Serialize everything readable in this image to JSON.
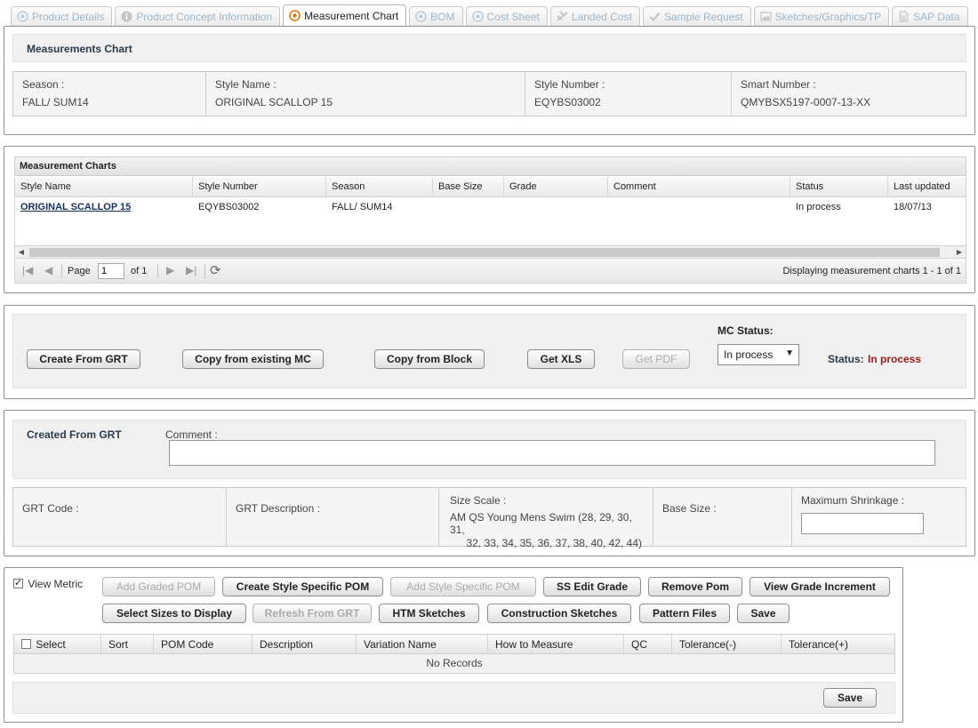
{
  "tabs": [
    {
      "label": "Product Details",
      "icon": "eye-icon",
      "active": false
    },
    {
      "label": "Product Concept Information",
      "icon": "info-icon",
      "active": false
    },
    {
      "label": "Measurement Chart",
      "icon": "eye-icon",
      "active": true
    },
    {
      "label": "BOM",
      "icon": "eye-icon",
      "active": false
    },
    {
      "label": "Cost Sheet",
      "icon": "eye-icon",
      "active": false
    },
    {
      "label": "Landed Cost",
      "icon": "plane-icon",
      "active": false
    },
    {
      "label": "Sample Request",
      "icon": "check-icon",
      "active": false
    },
    {
      "label": "Sketches/Graphics/TP",
      "icon": "image-icon",
      "active": false
    },
    {
      "label": "SAP Data",
      "icon": "document-icon",
      "active": false
    }
  ],
  "summary": {
    "title": "Measurements Chart",
    "season_label": "Season :",
    "season_value": "FALL/ SUM14",
    "style_name_label": "Style Name :",
    "style_name_value": "ORIGINAL SCALLOP 15",
    "style_number_label": "Style Number :",
    "style_number_value": "EQYBS03002",
    "smart_number_label": "Smart Number :",
    "smart_number_value": "QMYBSX5197-0007-13-XX"
  },
  "grid": {
    "title": "Measurement Charts",
    "columns": [
      "Style Name",
      "Style Number",
      "Season",
      "Base Size",
      "Grade",
      "Comment",
      "Status",
      "Last updated"
    ],
    "rows": [
      {
        "style_name": "ORIGINAL SCALLOP 15",
        "style_number": "EQYBS03002",
        "season": "FALL/ SUM14",
        "base_size": "",
        "grade": "",
        "comment": "",
        "status": "In process",
        "last_updated": "18/07/13"
      }
    ],
    "pager": {
      "page_label": "Page",
      "page_value": "1",
      "of_label": "of 1",
      "display_text": "Displaying measurement charts 1 - 1 of 1"
    }
  },
  "actions": {
    "create_from_grt": "Create From GRT",
    "copy_existing": "Copy from existing MC",
    "copy_block": "Copy from Block",
    "get_xls": "Get XLS",
    "get_pdf": "Get PDF",
    "mc_status_label": "MC Status:",
    "mc_status_value": "In process",
    "status_label": "Status:",
    "status_value": "In process",
    "status_color": "#9b1b1b"
  },
  "grt": {
    "created_from": "Created From GRT",
    "comment_label": "Comment :",
    "comment_value": "",
    "grt_code_label": "GRT Code :",
    "grt_desc_label": "GRT Description :",
    "size_scale_label": "Size Scale :",
    "size_scale_value_1": "AM QS Young Mens Swim (28, 29, 30, 31,",
    "size_scale_value_2": "32, 33, 34, 35, 36, 37, 38, 40, 42, 44)",
    "base_size_label": "Base Size :",
    "max_shrink_label": "Maximum Shrinkage :",
    "max_shrink_value": ""
  },
  "pom": {
    "view_metric": "View Metric",
    "view_metric_checked": true,
    "buttons": {
      "add_graded": "Add Graded POM",
      "create_style_specific": "Create Style Specific POM",
      "add_style_specific": "Add Style Specific POM",
      "ss_edit_grade": "SS Edit Grade",
      "remove_pom": "Remove Pom",
      "view_grade_increment": "View Grade Increment",
      "select_sizes": "Select Sizes to Display",
      "refresh_from_grt": "Refresh From GRT",
      "htm_sketches": "HTM Sketches",
      "construction_sketches": "Construction Sketches",
      "pattern_files": "Pattern Files",
      "save": "Save",
      "save_bottom": "Save"
    },
    "columns": [
      "Select",
      "Sort",
      "POM Code",
      "Description",
      "Variation Name",
      "How to Measure",
      "QC",
      "Tolerance(-)",
      "Tolerance(+)"
    ],
    "no_records": "No Records"
  }
}
